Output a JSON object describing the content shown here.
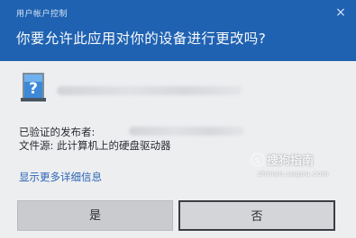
{
  "header": {
    "caption": "用户帐户控制",
    "question": "你要允许此应用对你的设备进行更改吗?",
    "close_glyph": "×"
  },
  "body": {
    "icon": "question-mark-app-icon",
    "publisher_label": "已验证的发布者:",
    "origin_label": "文件源: 此计算机上的硬盘驱动器",
    "more_details": "显示更多详细信息"
  },
  "buttons": {
    "yes": "是",
    "no": "否"
  },
  "watermark": {
    "title": "搜狗指南",
    "url": "zhinan.sogou.com"
  },
  "colors": {
    "header_bg": "#1f62b1",
    "body_bg": "#eceef0",
    "link": "#2c64b4"
  }
}
